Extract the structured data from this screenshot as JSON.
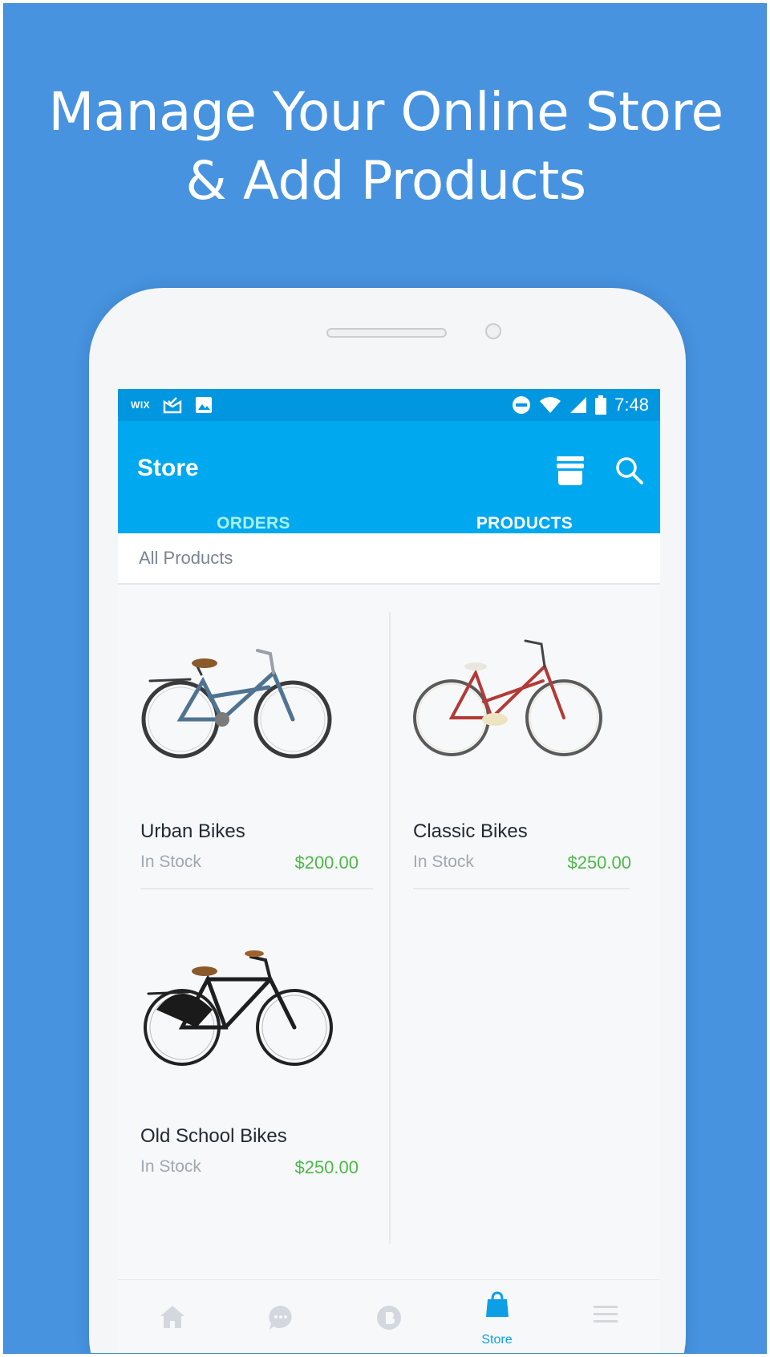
{
  "headline": {
    "line1": "Manage Your Online Store",
    "line2": "& Add Products"
  },
  "status_bar": {
    "brand": "WIX",
    "time": "7:48",
    "icons": [
      "wix-logo",
      "mail-icon",
      "image-icon",
      "do-not-disturb-icon",
      "wifi-icon",
      "signal-icon",
      "battery-icon"
    ]
  },
  "app_bar": {
    "title": "Store",
    "icons": [
      "storefront-icon",
      "search-icon"
    ]
  },
  "tabs": [
    {
      "label": "ORDERS",
      "selected": false
    },
    {
      "label": "PRODUCTS",
      "selected": true
    }
  ],
  "filter": {
    "label": "All Products"
  },
  "products": [
    {
      "name": "Urban Bikes",
      "stock": "In Stock",
      "price": "$200.00",
      "frame_color": "#4f7391"
    },
    {
      "name": "Classic Bikes",
      "stock": "In Stock",
      "price": "$250.00",
      "frame_color": "#b33a36"
    },
    {
      "name": "Old School Bikes",
      "stock": "In Stock",
      "price": "$250.00",
      "frame_color": "#1e1e1e"
    }
  ],
  "fab": {
    "icon": "plus-icon",
    "label": "+"
  },
  "bottom_nav": [
    {
      "icon": "home-icon",
      "label": "",
      "active": false
    },
    {
      "icon": "chat-icon",
      "label": "",
      "active": false
    },
    {
      "icon": "blog-icon",
      "label": "",
      "active": false
    },
    {
      "icon": "shopping-bag-icon",
      "label": "Store",
      "active": true
    },
    {
      "icon": "menu-icon",
      "label": "",
      "active": false
    }
  ],
  "colors": {
    "background": "#4793e0",
    "app_bar": "#00a8ef",
    "status_bar": "#0197e0",
    "price": "#4db848",
    "fab": "#09a5ee"
  }
}
